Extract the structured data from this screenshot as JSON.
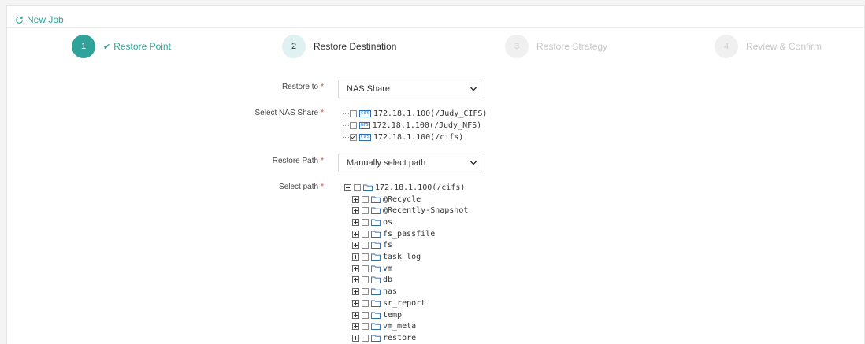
{
  "header": {
    "title": "New Job"
  },
  "steps": [
    {
      "number": "1",
      "label": "Restore Point",
      "state": "done"
    },
    {
      "number": "2",
      "label": "Restore Destination",
      "state": "current"
    },
    {
      "number": "3",
      "label": "Restore Strategy",
      "state": "todo"
    },
    {
      "number": "4",
      "label": "Review & Confirm",
      "state": "todo"
    }
  ],
  "form": {
    "restore_to": {
      "label": "Restore to",
      "value": "NAS Share"
    },
    "nas_share": {
      "label": "Select NAS Share",
      "items": [
        {
          "type": "CIFS",
          "path": "172.18.1.100(/Judy_CIFS)",
          "checked": false
        },
        {
          "type": "NFS",
          "path": "172.18.1.100(/Judy_NFS)",
          "checked": false
        },
        {
          "type": "CIFS",
          "path": "172.18.1.100(/cifs)",
          "checked": true
        }
      ]
    },
    "restore_path": {
      "label": "Restore Path",
      "value": "Manually select path"
    },
    "select_path": {
      "label": "Select path",
      "root": "172.18.1.100(/cifs)",
      "children": [
        "@Recycle",
        "@Recently-Snapshot",
        "os",
        "fs_passfile",
        "fs",
        "task_log",
        "vm",
        "db",
        "nas",
        "sr_report",
        "temp",
        "vm_meta",
        "restore"
      ]
    }
  },
  "colors": {
    "accent": "#2fa39a",
    "required": "#e0473b",
    "badge": "#2b6db3"
  },
  "icons": {
    "header": "refresh-icon",
    "done_step": "check-icon",
    "select": "chevron-down-icon",
    "folder": "folder-icon"
  }
}
